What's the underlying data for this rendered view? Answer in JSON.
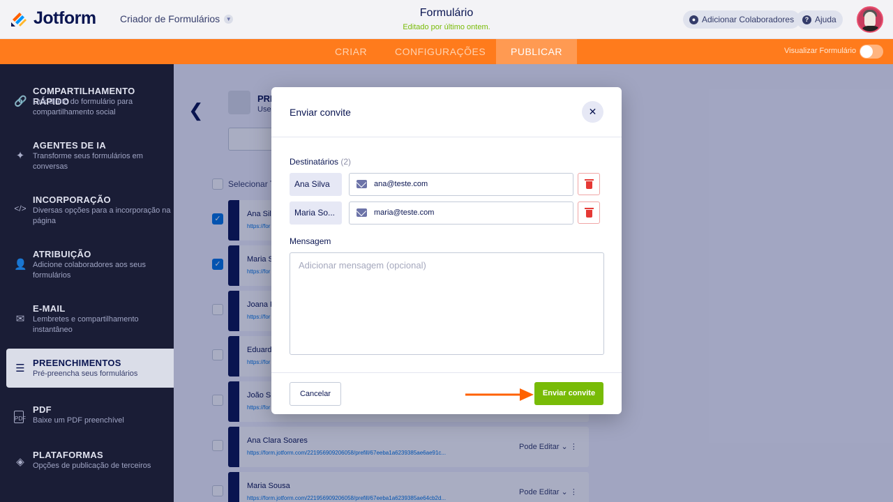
{
  "app": {
    "logo_text": "Jotform",
    "builder_label": "Criador de Formulários"
  },
  "header": {
    "form_title": "Formulário",
    "edited_label": "Editado por último ontem.",
    "add_collaborators": "Adicionar Colaboradores",
    "help": "Ajuda"
  },
  "nav": {
    "tabs": [
      "CRIAR",
      "CONFIGURAÇÕES",
      "PUBLICAR"
    ],
    "active_tab": "PUBLICAR",
    "preview_label": "Visualizar Formulário"
  },
  "colors": {
    "brand_orange": "#ff7b1c",
    "sidebar_bg": "#1a1d36",
    "accent_green": "#78bb07",
    "navy": "#0a1551"
  },
  "sidebar": {
    "items": [
      {
        "title": "COMPARTILHAMENTO RÁPIDO",
        "desc": "Link direto do formulário para compartilhamento social",
        "icon": "link-icon"
      },
      {
        "title": "AGENTES DE IA",
        "desc": "Transforme seus formulários em conversas",
        "icon": "sparkle-icon"
      },
      {
        "title": "INCORPORAÇÃO",
        "desc": "Diversas opções para a incorporação na página",
        "icon": "code-icon"
      },
      {
        "title": "ATRIBUIÇÃO",
        "desc": "Adicione colaboradores aos seus formulários",
        "icon": "user-add-icon"
      },
      {
        "title": "E-MAIL",
        "desc": "Lembretes e compartilhamento instantâneo",
        "icon": "mail-icon"
      },
      {
        "title": "PREENCHIMENTOS",
        "desc": "Pré-preencha seus formulários",
        "icon": "stack-icon"
      },
      {
        "title": "PDF",
        "desc": "Baixe um PDF preenchível",
        "icon": "pdf-icon"
      },
      {
        "title": "PLATAFORMAS",
        "desc": "Opções de publicação de terceiros",
        "icon": "layers-icon"
      }
    ],
    "active_index": 5
  },
  "background": {
    "section_title": "PRE",
    "section_sub": "Use",
    "select_all": "Selecionar To",
    "rows": [
      {
        "name": "Ana Silv",
        "link": "https://for",
        "checked": true
      },
      {
        "name": "Maria S",
        "link": "https://for",
        "checked": true
      },
      {
        "name": "Joana F",
        "link": "https://for",
        "checked": false
      },
      {
        "name": "Eduardo",
        "link": "https://for",
        "checked": false
      },
      {
        "name": "João Si",
        "link": "https://for",
        "checked": false
      },
      {
        "name": "Ana Clara Soares",
        "link": "https://form.jotform.com/221956909206058/prefill/67eeba1a6239385ae6ae91c...",
        "perm": "Pode Editar",
        "checked": false
      },
      {
        "name": "Maria Sousa",
        "link": "https://form.jotform.com/221956909206058/prefill/67eeba1a6239385ae64cb2d...",
        "perm": "Pode Editar",
        "checked": false
      }
    ]
  },
  "modal": {
    "title": "Enviar convite",
    "recipients_label": "Destinatários",
    "recipients_count": "(2)",
    "recipients": [
      {
        "name": "Ana Silva",
        "email": "ana@teste.com"
      },
      {
        "name": "Maria So...",
        "email": "maria@teste.com"
      }
    ],
    "message_label": "Mensagem",
    "message_placeholder": "Adicionar mensagem (opcional)",
    "message_value": "",
    "cancel_label": "Cancelar",
    "send_label": "Enviar convite"
  }
}
